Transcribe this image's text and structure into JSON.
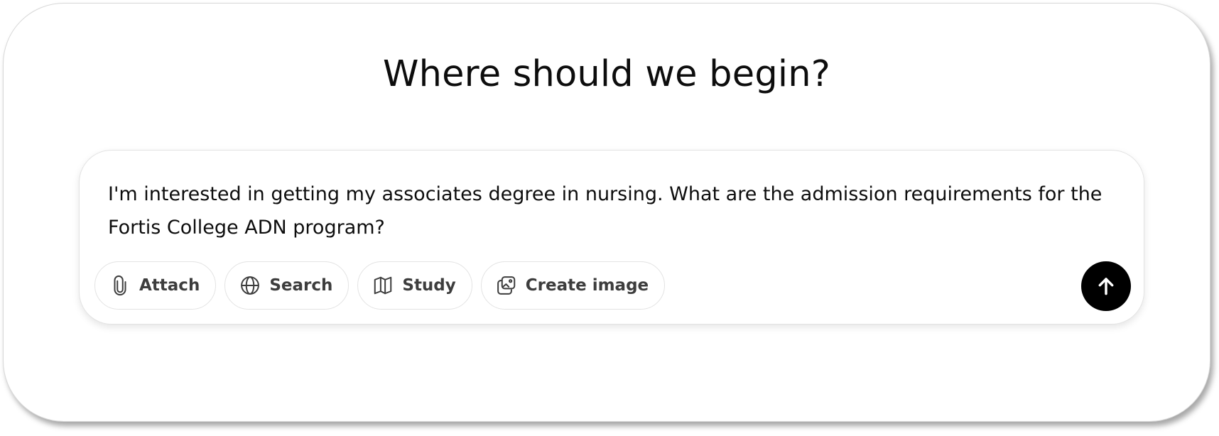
{
  "headline": "Where should we begin?",
  "composer": {
    "input_value": "I'm interested in getting my associates degree in nursing. What are the admission requirements for the Fortis College ADN program?",
    "tools": [
      {
        "label": "Attach",
        "icon": "paperclip-icon"
      },
      {
        "label": "Search",
        "icon": "globe-icon"
      },
      {
        "label": "Study",
        "icon": "book-open-icon"
      },
      {
        "label": "Create image",
        "icon": "image-icon"
      }
    ],
    "send_icon": "arrow-up-icon"
  },
  "colors": {
    "send_button": "#000000",
    "text": "#0d0d0d",
    "tool_text": "#3d3d3d",
    "border": "#e3e3e3"
  }
}
